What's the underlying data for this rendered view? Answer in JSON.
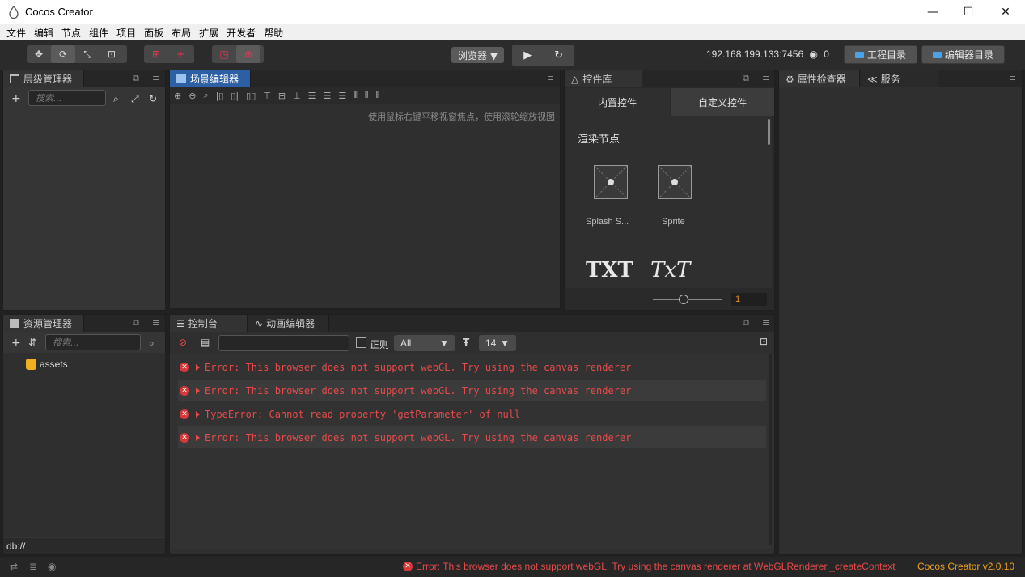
{
  "window": {
    "title": "Cocos Creator",
    "min": "—",
    "max": "☐",
    "close": "✕"
  },
  "menu": [
    "文件",
    "编辑",
    "节点",
    "组件",
    "项目",
    "面板",
    "布局",
    "扩展",
    "开发者",
    "帮助"
  ],
  "toolbar": {
    "browser_select": "浏览器 ▼",
    "ip": "192.168.199.133:7456",
    "clients": "0",
    "project_dir": "工程目录",
    "editor_dir": "编辑器目录"
  },
  "hierarchy": {
    "tab": "层级管理器",
    "search_placeholder": "搜索..."
  },
  "scene": {
    "tab": "场景编辑器",
    "hint": "使用鼠标右键平移视窗焦点，使用滚轮缩放视图"
  },
  "widgets": {
    "tab": "控件库",
    "tab_builtin": "内置控件",
    "tab_custom": "自定义控件",
    "section": "渲染节点",
    "items": [
      "Splash S...",
      "Sprite"
    ],
    "text_items": [
      "TXT",
      "TxT"
    ],
    "zoom_value": "1"
  },
  "inspector": {
    "tab": "属性检查器",
    "tab2": "服务"
  },
  "assets": {
    "tab": "资源管理器",
    "search_placeholder": "搜索...",
    "root": "assets",
    "path": "db://"
  },
  "console": {
    "tab": "控制台",
    "tab2": "动画编辑器",
    "regex_label": "正则",
    "level": "All",
    "font_size": "14",
    "logs": [
      "Error: This browser does not support webGL. Try using the canvas renderer",
      "Error: This browser does not support webGL. Try using the canvas renderer",
      "TypeError: Cannot read property 'getParameter' of null",
      "Error: This browser does not support webGL. Try using the canvas renderer"
    ]
  },
  "status": {
    "message": "Error: This browser does not support webGL. Try using the canvas renderer at WebGLRenderer._createContext",
    "version": "Cocos Creator v2.0.10"
  },
  "colors": {
    "error": "#e84a4a",
    "version": "#f0a020",
    "accent_tab": "#2c5fa3"
  }
}
